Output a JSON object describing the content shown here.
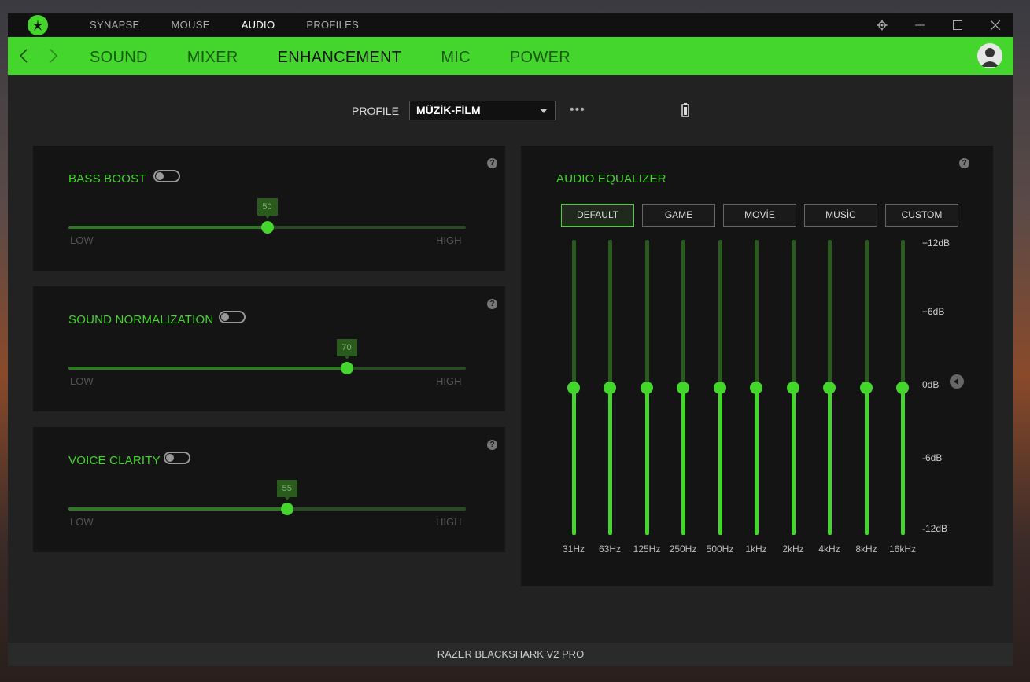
{
  "top_nav": {
    "items": [
      {
        "label": "SYNAPSE",
        "active": false
      },
      {
        "label": "MOUSE",
        "active": false
      },
      {
        "label": "AUDIO",
        "active": true
      },
      {
        "label": "PROFILES",
        "active": false
      }
    ]
  },
  "sub_nav": {
    "items": [
      {
        "label": "SOUND",
        "active": false
      },
      {
        "label": "MIXER",
        "active": false
      },
      {
        "label": "ENHANCEMENT",
        "active": true
      },
      {
        "label": "MIC",
        "active": false
      },
      {
        "label": "POWER",
        "active": false
      }
    ]
  },
  "profile": {
    "label": "PROFILE",
    "selected": "MÜZİK-FİLM",
    "more": "•••"
  },
  "enhancements": [
    {
      "title": "BASS BOOST",
      "enabled": false,
      "value": 50,
      "low": "LOW",
      "high": "HIGH"
    },
    {
      "title": "SOUND NORMALIZATION",
      "enabled": false,
      "value": 70,
      "low": "LOW",
      "high": "HIGH"
    },
    {
      "title": "VOICE CLARITY",
      "enabled": false,
      "value": 55,
      "low": "LOW",
      "high": "HIGH"
    }
  ],
  "equalizer": {
    "title": "AUDIO EQUALIZER",
    "presets": [
      {
        "label": "DEFAULT",
        "active": true
      },
      {
        "label": "GAME",
        "active": false
      },
      {
        "label": "MOVİE",
        "active": false
      },
      {
        "label": "MUSİC",
        "active": false
      },
      {
        "label": "CUSTOM",
        "active": false
      }
    ],
    "db_labels": [
      "+12dB",
      "+6dB",
      "0dB",
      "-6dB",
      "-12dB"
    ],
    "bands": [
      {
        "freq": "31Hz",
        "gain_db": 0
      },
      {
        "freq": "63Hz",
        "gain_db": 0
      },
      {
        "freq": "125Hz",
        "gain_db": 0
      },
      {
        "freq": "250Hz",
        "gain_db": 0
      },
      {
        "freq": "500Hz",
        "gain_db": 0
      },
      {
        "freq": "1kHz",
        "gain_db": 0
      },
      {
        "freq": "2kHz",
        "gain_db": 0
      },
      {
        "freq": "4kHz",
        "gain_db": 0
      },
      {
        "freq": "8kHz",
        "gain_db": 0
      },
      {
        "freq": "16kHz",
        "gain_db": 0
      }
    ]
  },
  "help_glyph": "?",
  "footer": {
    "device": "RAZER BLACKSHARK V2 PRO"
  },
  "colors": {
    "accent": "#44d62c",
    "background": "#222222",
    "panel": "#141414"
  }
}
